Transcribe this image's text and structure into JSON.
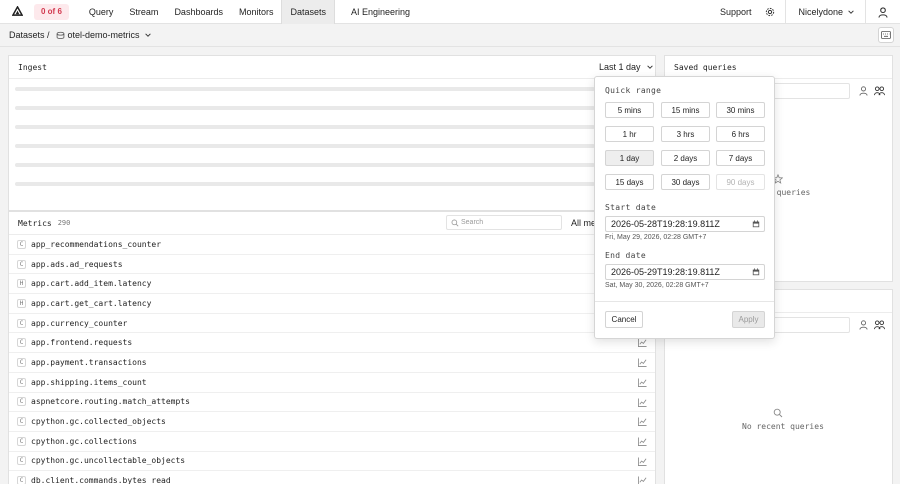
{
  "nav": {
    "badge": "0 of 6",
    "items": [
      "Query",
      "Stream",
      "Dashboards",
      "Monitors",
      "Datasets",
      "AI Engineering"
    ],
    "active": "Datasets",
    "support": "Support",
    "user": "Nicelydone"
  },
  "breadcrumb": {
    "root": "Datasets /",
    "dataset": "otel-demo-metrics"
  },
  "ingest": {
    "title": "Ingest",
    "range": "Last 1 day"
  },
  "metrics": {
    "title": "Metrics",
    "count": "290",
    "search_placeholder": "Search",
    "filter": "All met",
    "rows": [
      {
        "type": "C",
        "name": "app_recommendations_counter"
      },
      {
        "type": "C",
        "name": "app.ads.ad_requests"
      },
      {
        "type": "H",
        "name": "app.cart.add_item.latency"
      },
      {
        "type": "H",
        "name": "app.cart.get_cart.latency"
      },
      {
        "type": "C",
        "name": "app.currency_counter"
      },
      {
        "type": "C",
        "name": "app.frontend.requests"
      },
      {
        "type": "C",
        "name": "app.payment.transactions"
      },
      {
        "type": "C",
        "name": "app.shipping.items_count"
      },
      {
        "type": "C",
        "name": "aspnetcore.routing.match_attempts"
      },
      {
        "type": "C",
        "name": "cpython.gc.collected_objects"
      },
      {
        "type": "C",
        "name": "cpython.gc.collections"
      },
      {
        "type": "C",
        "name": "cpython.gc.uncollectable_objects"
      },
      {
        "type": "C",
        "name": "db.client.commands.bytes_read"
      }
    ]
  },
  "saved_queries": {
    "title": "Saved queries",
    "empty": "d queries"
  },
  "recent_queries": {
    "empty": "No recent queries"
  },
  "popover": {
    "quick_range_label": "Quick range",
    "ranges": [
      {
        "label": "5 mins",
        "state": "normal"
      },
      {
        "label": "15 mins",
        "state": "normal"
      },
      {
        "label": "30 mins",
        "state": "normal"
      },
      {
        "label": "1 hr",
        "state": "normal"
      },
      {
        "label": "3 hrs",
        "state": "normal"
      },
      {
        "label": "6 hrs",
        "state": "normal"
      },
      {
        "label": "1 day",
        "state": "selected"
      },
      {
        "label": "2 days",
        "state": "normal"
      },
      {
        "label": "7 days",
        "state": "normal"
      },
      {
        "label": "15 days",
        "state": "normal"
      },
      {
        "label": "30 days",
        "state": "normal"
      },
      {
        "label": "90 days",
        "state": "disabled"
      }
    ],
    "start_label": "Start date",
    "start_value": "2026-05-28T19:28:19.811Z",
    "start_sub": "Fri, May 29, 2026, 02:28  GMT+7",
    "end_label": "End date",
    "end_value": "2026-05-29T19:28:19.811Z",
    "end_sub": "Sat, May 30, 2026, 02:28  GMT+7",
    "cancel": "Cancel",
    "apply": "Apply"
  }
}
